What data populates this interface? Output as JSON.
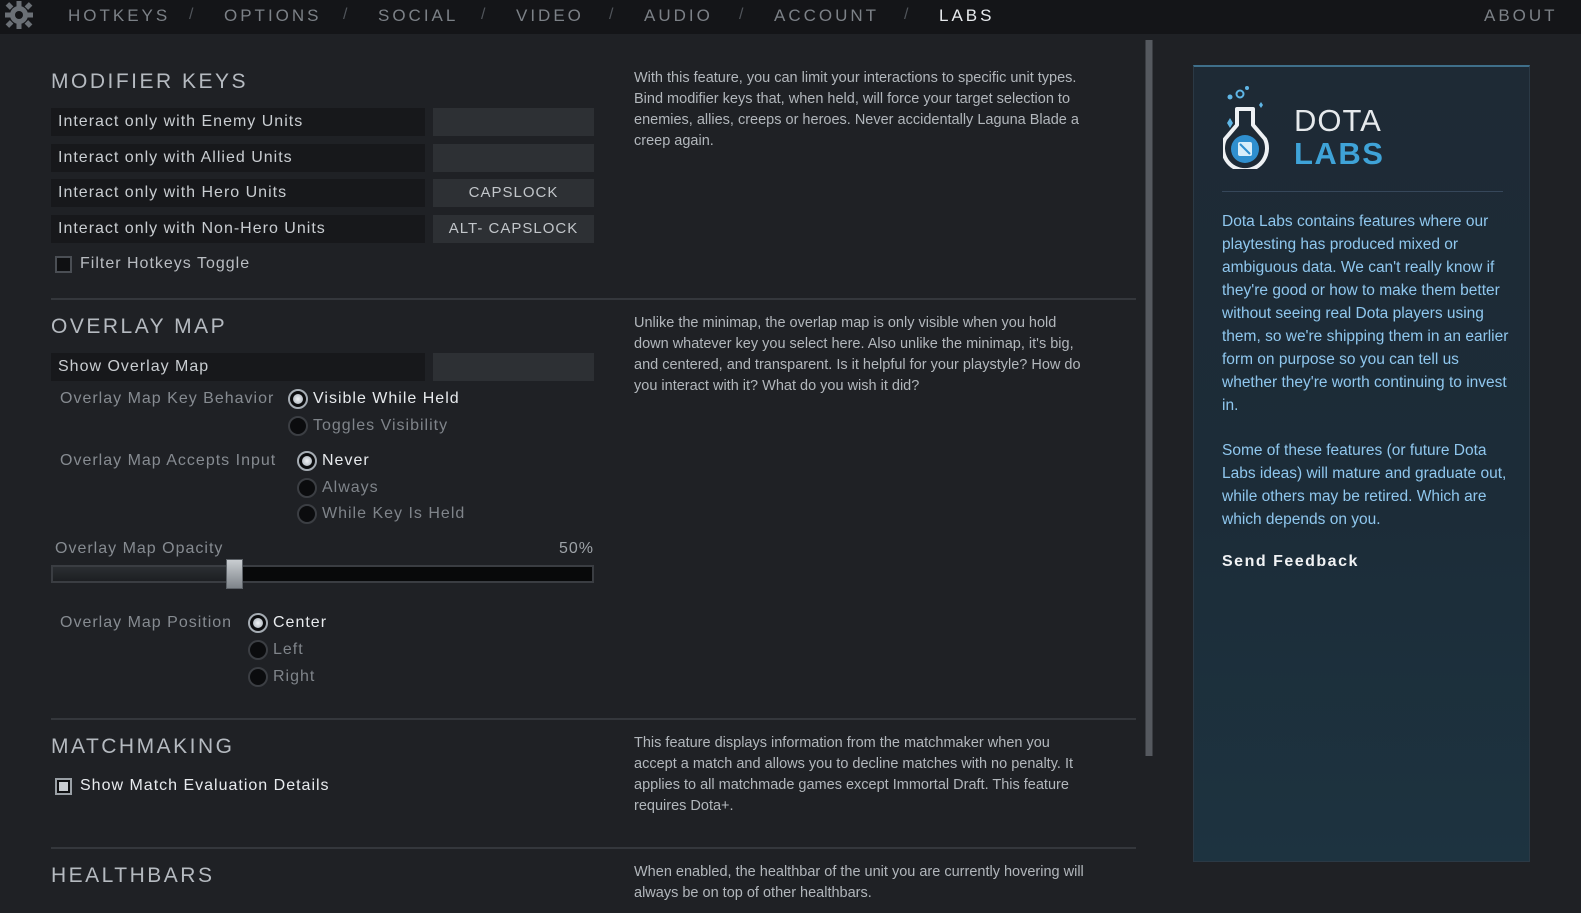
{
  "nav": {
    "items": [
      {
        "label": "HOTKEYS"
      },
      {
        "label": "OPTIONS"
      },
      {
        "label": "SOCIAL"
      },
      {
        "label": "VIDEO"
      },
      {
        "label": "AUDIO"
      },
      {
        "label": "ACCOUNT"
      },
      {
        "label": "LABS"
      }
    ],
    "separator": "/",
    "active": "LABS",
    "about": "ABOUT"
  },
  "modifier_keys": {
    "title": "MODIFIER KEYS",
    "description": "With this feature, you can limit your interactions to specific unit types. Bind modifier keys that, when held, will force your target selection to enemies, allies, creeps or heroes. Never accidentally Laguna Blade a creep again.",
    "bindings": [
      {
        "label": "Interact only with Enemy Units",
        "key": ""
      },
      {
        "label": "Interact only with Allied Units",
        "key": ""
      },
      {
        "label": "Interact only with Hero Units",
        "key": "CAPSLOCK"
      },
      {
        "label": "Interact only with Non-Hero Units",
        "key": "ALT- CAPSLOCK"
      }
    ],
    "filter_toggle": {
      "label": "Filter Hotkeys Toggle",
      "checked": false
    }
  },
  "overlay_map": {
    "title": "OVERLAY MAP",
    "description": "Unlike the minimap, the overlap map is only visible when you hold down whatever key you select here. Also unlike the minimap, it's big, and centered, and transparent. Is it helpful for your playstyle? How do you interact with it? What do you wish it did?",
    "show_binding": {
      "label": "Show Overlay Map",
      "key": ""
    },
    "key_behavior": {
      "label": "Overlay Map Key Behavior",
      "options": [
        "Visible While Held",
        "Toggles Visibility"
      ],
      "selected": "Visible While Held"
    },
    "accepts_input": {
      "label": "Overlay Map Accepts Input",
      "options": [
        "Never",
        "Always",
        "While Key Is Held"
      ],
      "selected": "Never"
    },
    "opacity": {
      "label": "Overlay Map Opacity",
      "value_text": "50%",
      "value": 0.5
    },
    "position": {
      "label": "Overlay Map Position",
      "options": [
        "Center",
        "Left",
        "Right"
      ],
      "selected": "Center"
    }
  },
  "matchmaking": {
    "title": "MATCHMAKING",
    "description": "This feature displays information from the matchmaker when you accept a match and allows you to decline matches with no penalty. It applies to all matchmade games except Immortal Draft. This feature requires Dota+.",
    "checkbox": {
      "label": "Show Match Evaluation Details",
      "checked": false
    }
  },
  "healthbars": {
    "title": "HEALTHBARS",
    "description": "When enabled, the healthbar of the unit you are currently hovering will always be on top of other healthbars."
  },
  "labs_panel": {
    "title_line1": "DOTA",
    "title_line2": "LABS",
    "paragraph1": "Dota Labs contains features where our playtesting has produced mixed or ambiguous data. We can't really know if they're good or how to make them better without seeing real Dota players using them, so we're shipping them in an earlier form on purpose so you can tell us whether they're worth continuing to invest in.",
    "paragraph2": "Some of these features (or future Dota Labs ideas) will mature and graduate out, while others may be retired. Which are which depends on you.",
    "feedback_link": "Send Feedback"
  },
  "colors": {
    "background": "#1f2125",
    "topbar": "#141518",
    "labs_accent": "#3fa3d8",
    "labs_text": "#8fc7ee"
  }
}
